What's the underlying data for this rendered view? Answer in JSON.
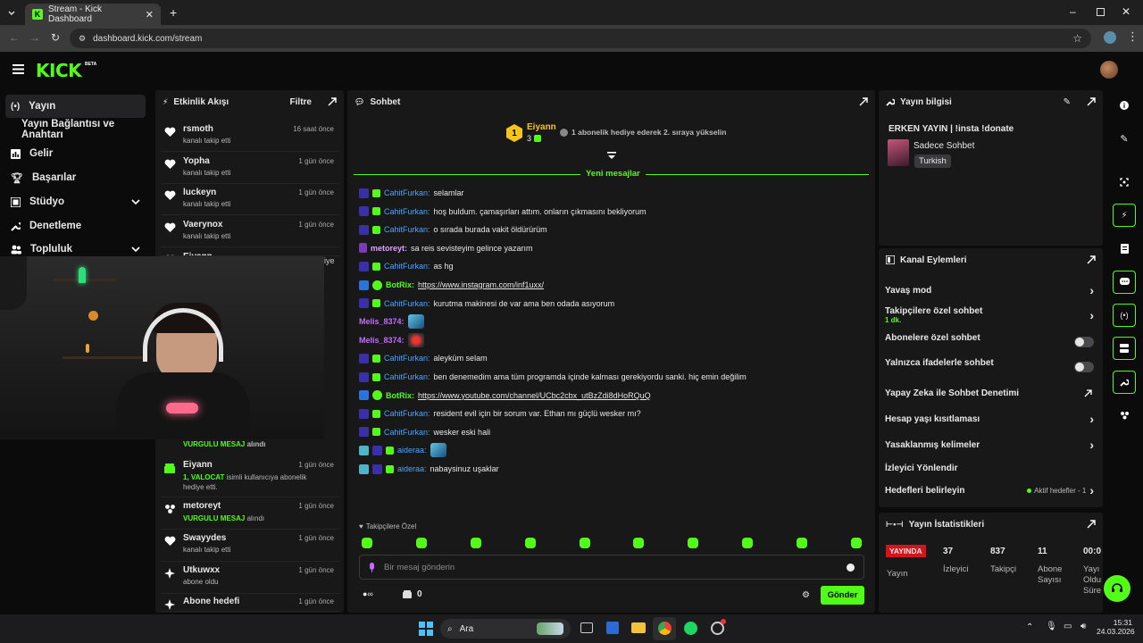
{
  "browser": {
    "tab_title": "Stream - Kick Dashboard",
    "url": "dashboard.kick.com/stream"
  },
  "header": {
    "logo": "KICK",
    "logo_tag": "BETA"
  },
  "nav": {
    "items": [
      {
        "label": "Yayın",
        "icon": "broadcast-icon"
      },
      {
        "label": "Yayın Bağlantısı ve Anahtarı"
      },
      {
        "label": "Gelir",
        "icon": "chart-icon"
      },
      {
        "label": "Başarılar",
        "icon": "trophy-icon"
      },
      {
        "label": "Stüdyo",
        "icon": "studio-icon"
      },
      {
        "label": "Denetleme",
        "icon": "wrench-icon"
      },
      {
        "label": "Topluluk",
        "icon": "people-icon"
      }
    ]
  },
  "activity": {
    "title": "Etkinlik Akışı",
    "filter": "Filtre",
    "items_top": [
      {
        "name": "rsmoth",
        "sub": "kanalı takip etti",
        "time": "16 saat önce"
      },
      {
        "name": "Yopha",
        "sub": "kanalı takip etti",
        "time": "1 gün önce"
      },
      {
        "name": "luckeyn",
        "sub": "kanalı takip etti",
        "time": "1 gün önce"
      },
      {
        "name": "Vaerynox",
        "sub": "kanalı takip etti",
        "time": "1 gün önce"
      },
      {
        "name": "Eiyann"
      }
    ],
    "partial_right": "iye",
    "partial_highlight": "VURGULU MESAJ",
    "partial_sub": "alındı",
    "items_bottom": [
      {
        "name": "Eiyann",
        "hl": "1, VALOCAT",
        "sub": "isimli kullanıcıya abonelik hediye etti.",
        "time": "1 gün önce"
      },
      {
        "name": "metoreyt",
        "hl": "VURGULU MESAJ",
        "sub": "alındı",
        "time": "1 gün önce"
      },
      {
        "name": "Swayydes",
        "sub": "kanalı takip etti",
        "time": "1 gün önce"
      },
      {
        "name": "Utkuwxx",
        "sub": "abone oldu",
        "time": "1 gün önce"
      },
      {
        "name": "Abone hedefi",
        "time": "1 gün önce"
      }
    ]
  },
  "chat": {
    "title": "Sohbet",
    "pinned_user": "Eiyann",
    "pinned_rank": "1",
    "pinned_count": "3",
    "pinned_text": "1 abonelik hediye ederek 2. sıraya yükselin",
    "new_messages": "Yeni mesajlar",
    "messages": [
      {
        "user": "CahitFurkan",
        "text": "selamlar",
        "color": "#4da3ff"
      },
      {
        "user": "CahitFurkan",
        "text": "hoş buldum. çamaşırları attım. onların çıkmasını bekliyorum",
        "color": "#4da3ff"
      },
      {
        "user": "CahitFurkan",
        "text": "o sırada burada vakit öldürürüm",
        "color": "#4da3ff"
      },
      {
        "user": "metoreyt",
        "text": "sa reis sevisteyim gelince yazarım",
        "color": "#e0a0ff"
      },
      {
        "user": "CahitFurkan",
        "text": "as hg",
        "color": "#4da3ff"
      },
      {
        "user": "BotRix",
        "text": "https://www.instagram.com/inf1uxx/",
        "color": "#53fc18",
        "link": true
      },
      {
        "user": "CahitFurkan",
        "text": "kurutma makinesi de var ama ben odada asıyorum",
        "color": "#4da3ff"
      },
      {
        "user": "Melis_8374",
        "text": "",
        "color": "#c36bff",
        "emote": "emote-a"
      },
      {
        "user": "Melis_8374",
        "text": "",
        "color": "#c36bff",
        "emote": "emote-b"
      },
      {
        "user": "CahitFurkan",
        "text": "aleyküm selam",
        "color": "#4da3ff"
      },
      {
        "user": "CahitFurkan",
        "text": "ben denemedim ama tüm programda içinde kalması gerekiyordu sanki. hiç emin değilim",
        "color": "#4da3ff"
      },
      {
        "user": "BotRix",
        "text": "https://www.youtube.com/channel/UCbc2cbx_utBzZdi8dHoRQuQ",
        "color": "#53fc18",
        "link": true
      },
      {
        "user": "CahitFurkan",
        "text": "resident evil için bir sorum var. Ethan mı güçlü wesker mı?",
        "color": "#4da3ff"
      },
      {
        "user": "CahitFurkan",
        "text": "wesker eski hali",
        "color": "#4da3ff"
      },
      {
        "user": "aideraa",
        "text": "",
        "color": "#4da3ff",
        "emote": "emote-a"
      },
      {
        "user": "aideraa",
        "text": "nabaysinuz uşaklar",
        "color": "#4da3ff"
      }
    ],
    "followers_only": "Takipçilere Özel",
    "input_placeholder": "Bir mesaj gönderin",
    "points": "0",
    "send": "Gönder"
  },
  "stream_info": {
    "title": "Yayın bilgisi",
    "stream_title": "ERKEN YAYIN | !insta !donate",
    "category": "Sadece Sohbet",
    "language": "Turkish"
  },
  "channel_actions": {
    "title": "Kanal Eylemleri",
    "slow_mode": "Yavaş mod",
    "followers_chat": "Takipçilere özel sohbet",
    "followers_chat_sub": "1 dk.",
    "subs_chat": "Abonelere özel sohbet",
    "emote_chat": "Yalnızca ifadelerle sohbet",
    "ai_mod": "Yapay Zeka ile Sohbet Denetimi",
    "age": "Hesap yaşı kısıtlaması",
    "banned_words": "Yasaklanmış kelimeler",
    "redirect": "İzleyici Yönlendir",
    "goals": "Hedefleri belirleyin",
    "goals_status": "Aktif hedefler - 1"
  },
  "stats": {
    "title": "Yayın İstatistikleri",
    "live": "YAYINDA",
    "live_sub": "Yayın",
    "viewers": "37",
    "viewers_lbl": "İzleyici",
    "followers": "837",
    "followers_lbl": "Takipçi",
    "subs": "11",
    "subs_lbl1": "Abone",
    "subs_lbl2": "Sayısı",
    "time": "00:0",
    "time_lbl1": "Yayı",
    "time_lbl2": "Oldu",
    "time_lbl3": "Süre"
  },
  "taskbar": {
    "search": "Ara",
    "time": "15:31",
    "date": "24.03.2026"
  },
  "colors": {
    "accent": "#53fc18",
    "panel": "#181819",
    "bg": "#0b0b0c",
    "live": "#d4131a"
  }
}
